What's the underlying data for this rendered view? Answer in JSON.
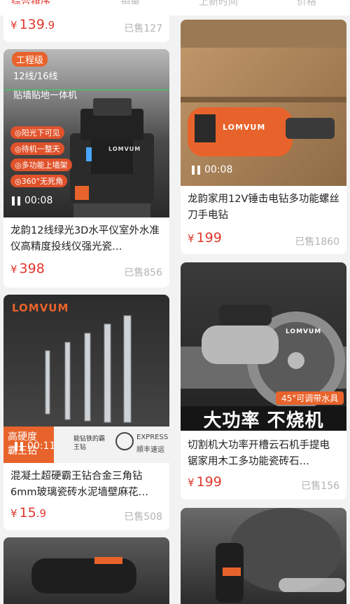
{
  "tabs": [
    "综合排序",
    "销量",
    "上新时间",
    "价格"
  ],
  "cards": [
    {
      "id": "c0",
      "price_int": "139",
      "price_dec": ".9",
      "sold": "已售127"
    },
    {
      "id": "c1",
      "badge": "工程级",
      "spec1": "12线/16线",
      "spec2": "贴墙贴地一体机",
      "bullets": [
        "◎阳光下可见",
        "◎待机一整天",
        "◎多功能上墙架",
        "◎360°无死角"
      ],
      "brand": "LOMVUM",
      "duration": "00:08",
      "title": "龙韵12线绿光3D水平仪室外水准仪高精度投线仪强光瓷…",
      "price_int": "398",
      "price_dec": "",
      "sold": "已售856"
    },
    {
      "id": "c2",
      "brand": "LOMVUM",
      "duration": "00:08",
      "title": "龙韵家用12V锤击电钻多功能螺丝刀手电钻",
      "price_int": "199",
      "price_dec": "",
      "sold": "已售1860"
    },
    {
      "id": "c3",
      "brand": "LOMVUM",
      "duration": "00:11",
      "corner1": "高硬度",
      "corner2": "霸王钻",
      "feature": "能钻铁的霸王钻",
      "express1": "EXPRESS",
      "express2": "顺丰速运",
      "title": "混凝土超硬霸王钻合金三角钻6mm玻璃瓷砖水泥墙壁麻花…",
      "price_int": "15",
      "price_dec": ".9",
      "sold": "已售508"
    },
    {
      "id": "c4",
      "brand": "LOMVUM",
      "tag": "45°可调带水具",
      "headline": "大功率 不烧机",
      "title": "切割机大功率开槽云石机手提电锯家用木工多功能瓷砖石…",
      "price_int": "199",
      "price_dec": "",
      "sold": "已售156"
    }
  ],
  "currency": "¥",
  "colors": {
    "accent": "#e0382d",
    "orange": "#e8632b"
  }
}
